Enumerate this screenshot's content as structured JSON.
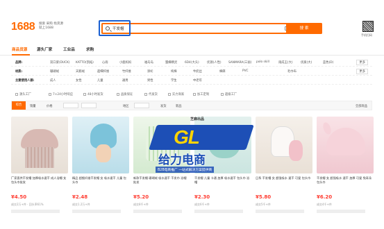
{
  "header": {
    "logo": "1688",
    "slogan_lines": [
      "搜索 采购 找货源",
      "就上1688"
    ],
    "search_query": "干发帽",
    "search_button": "搜 索",
    "qr_caption": "手机扫码"
  },
  "nav": {
    "tabs": [
      "商品货源",
      "源头厂家",
      "工业品",
      "求购"
    ]
  },
  "filters": {
    "rows": [
      {
        "label": "品牌:",
        "items": [
          "双口紫(DUCK)",
          "KATTO(凯拓)",
          "心雨",
          "小鹿妈妈",
          "福岛岛",
          "蜜蜂精灵",
          "6D4(大头)",
          "优源(人性)",
          "SANMARA(三丽)",
          "polo skill",
          "雨成王(大)",
          "优质(大)",
          "蓝色(D)"
        ],
        "more": "更多"
      },
      {
        "label": "材质:",
        "items": [
          "珊瑚绒",
          "天鹅绒",
          "超细纤维",
          "竹纤维",
          "涤纶",
          "纯棉",
          "牛奶丝",
          "棉麻",
          "PVC",
          "毛巾布"
        ],
        "more": "更多"
      },
      {
        "label": "主要使用人群:",
        "items": [
          "成人",
          "女性",
          "儿童",
          "通用",
          "男性",
          "学生",
          "中老年"
        ],
        "more": ""
      }
    ]
  },
  "checks": [
    "源头工厂",
    "7×24小时响应",
    "48小时发货",
    "品质保证",
    "代发货",
    "实力商家",
    "加工定制",
    "超级工厂"
  ],
  "sortbar": {
    "items": [
      "综合",
      "销量",
      "价格",
      "地区",
      "发货",
      "新品"
    ],
    "active": "综合",
    "right": "全部商品"
  },
  "products": [
    {
      "title": "厂家直供干发帽 加厚吸水速干 成人浴帽 女包头巾批发",
      "price": "¥4.50",
      "meta": "成交2万+件 · 回头率61%"
    },
    {
      "title": "精品 超细纤维干发帽 女 吸水速干 儿童 包头巾",
      "price": "¥2.48",
      "meta": "成交1.2万+件"
    },
    {
      "title": "新款干发帽 珊瑚绒 吸水速干 干发巾 浴帽 批发",
      "price": "¥5.20",
      "meta": "成交8千+件"
    },
    {
      "title": "干发帽 儿童 卡通 加厚 吸水速干 包头巾 浴帽",
      "price": "¥2.30",
      "meta": "成交6千+件"
    },
    {
      "title": "日系 干发帽 女 超强吸水 速干 可爱 包头巾",
      "price": "¥5.80",
      "meta": "成交5千+件"
    },
    {
      "title": "干发帽 女 超强吸水 速干 加厚 可爱 兔耳朵 包头巾",
      "price": "¥6.20",
      "meta": "成交4千+件"
    }
  ],
  "watermark": {
    "brand": "芝麻出品",
    "logo": "GL",
    "title": "给力电商",
    "subtitle": "B2B电商推广 一站式解决方案提供商"
  },
  "colors": {
    "accent": "#ff6a00",
    "price": "#ff3b30",
    "watermark_blue": "#1d4fb6",
    "watermark_yellow": "#ffd400"
  }
}
